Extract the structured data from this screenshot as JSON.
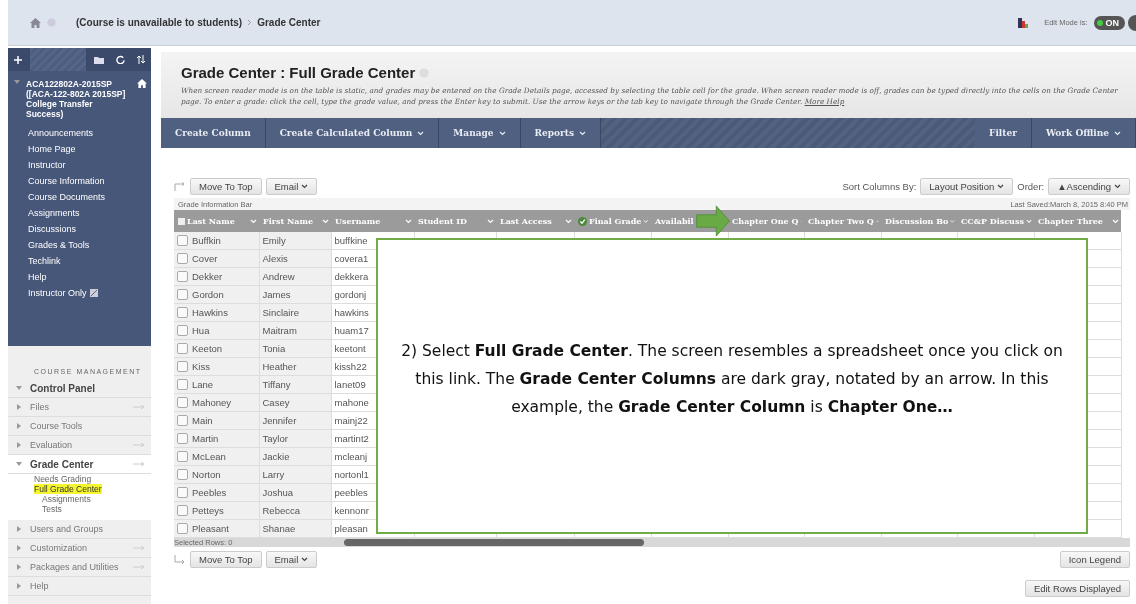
{
  "breadcrumb": {
    "items": [
      "(Course is unavailable to students)",
      "Grade Center"
    ]
  },
  "edit_mode": {
    "label": "Edit Mode is:",
    "value": "ON",
    "on": true
  },
  "sidebar": {
    "course_title": "ACA122802A-2015SP ([ACA-122-802A 2015SP] College Transfer Success)",
    "items": [
      {
        "label": "Announcements"
      },
      {
        "label": "Home Page"
      },
      {
        "label": "Instructor"
      },
      {
        "label": "Course Information"
      },
      {
        "label": "Course Documents"
      },
      {
        "label": "Assignments"
      },
      {
        "label": "Discussions"
      },
      {
        "label": "Grades & Tools"
      },
      {
        "label": "Techlink"
      },
      {
        "label": "Help"
      },
      {
        "label": "Instructor Only",
        "hidden_icon": true
      }
    ],
    "management_heading": "COURSE MANAGEMENT",
    "control_panel": "Control Panel",
    "panel_items": [
      {
        "label": "Files",
        "expanded": false,
        "quick_link": true
      },
      {
        "label": "Course Tools",
        "expanded": false,
        "quick_link": false
      },
      {
        "label": "Evaluation",
        "expanded": false,
        "quick_link": true
      },
      {
        "label": "Grade Center",
        "expanded": true,
        "quick_link": true,
        "children": [
          {
            "label": "Needs Grading",
            "selected": false
          },
          {
            "label": "Full Grade Center",
            "selected": true,
            "children": [
              {
                "label": "Assignments",
                "selected": false
              },
              {
                "label": "Tests",
                "selected": false
              }
            ]
          }
        ]
      },
      {
        "label": "Users and Groups",
        "expanded": false,
        "quick_link": false
      },
      {
        "label": "Customization",
        "expanded": false,
        "quick_link": true
      },
      {
        "label": "Packages and Utilities",
        "expanded": false,
        "quick_link": true
      },
      {
        "label": "Help",
        "expanded": false,
        "quick_link": false
      }
    ]
  },
  "page": {
    "title": "Grade Center : Full Grade Center",
    "description": "When screen reader mode is on the table is static, and grades may be entered on the Grade Details page, accessed by selecting the table cell for the grade. When screen reader mode is off, grades can be typed directly into the cells on the Grade Center page. To enter a grade: click the cell, type the grade value, and press the Enter key to submit. Use the arrow keys or the tab key to navigate through the Grade Center.",
    "help_link": "More Help"
  },
  "toolbar": {
    "left": [
      {
        "label": "Create Column",
        "menu": false
      },
      {
        "label": "Create Calculated Column",
        "menu": true
      },
      {
        "label": "Manage",
        "menu": true
      },
      {
        "label": "Reports",
        "menu": true
      }
    ],
    "right": [
      {
        "label": "Filter",
        "menu": false
      },
      {
        "label": "Work Offline",
        "menu": true
      }
    ]
  },
  "actions": {
    "move_to_top": "Move To Top",
    "email": "Email",
    "sort_label": "Sort Columns By:",
    "sort_value": "Layout Position",
    "order_label": "Order:",
    "order_value": "▲Ascending"
  },
  "info_bar": {
    "label": "Grade Information Bar",
    "last_saved": "Last Saved:March 8, 2015 8:40 PM"
  },
  "table": {
    "columns": [
      {
        "label": "Last Name"
      },
      {
        "label": "First Name"
      },
      {
        "label": "Username"
      },
      {
        "label": "Student ID"
      },
      {
        "label": "Last Access"
      },
      {
        "label": "Final Grade",
        "check": true
      },
      {
        "label": "Availabil"
      },
      {
        "label": "Chapter One Q"
      },
      {
        "label": "Chapter Two Q"
      },
      {
        "label": "Discussion Bo"
      },
      {
        "label": "CC&P Discuss"
      },
      {
        "label": "Chapter Three"
      }
    ],
    "rows": [
      {
        "last": "Buffkin",
        "first": "Emily",
        "user": "buffkine",
        "selected": false
      },
      {
        "last": "Cover",
        "first": "Alexis",
        "user": "covera1",
        "selected": false
      },
      {
        "last": "Dekker",
        "first": "Andrew",
        "user": "dekkera",
        "selected": false
      },
      {
        "last": "Gordon",
        "first": "James",
        "user": "gordonj",
        "selected": false
      },
      {
        "last": "Hawkins",
        "first": "Sinclaire",
        "user": "hawkins",
        "selected": false
      },
      {
        "last": "Hua",
        "first": "Maitram",
        "user": "huam17",
        "selected": false
      },
      {
        "last": "Keeton",
        "first": "Tonia",
        "user": "keetont",
        "selected": false
      },
      {
        "last": "Kiss",
        "first": "Heather",
        "user": "kissh22",
        "selected": false
      },
      {
        "last": "Lane",
        "first": "Tiffany",
        "user": "lanet09",
        "selected": false
      },
      {
        "last": "Mahoney",
        "first": "Casey",
        "user": "mahone",
        "selected": false
      },
      {
        "last": "Main",
        "first": "Jennifer",
        "user": "mainj22",
        "selected": false
      },
      {
        "last": "Martin",
        "first": "Taylor",
        "user": "martint2",
        "selected": false
      },
      {
        "last": "McLean",
        "first": "Jackie",
        "user": "mcleanj",
        "selected": false
      },
      {
        "last": "Norton",
        "first": "Larry",
        "user": "nortonl1",
        "selected": false
      },
      {
        "last": "Peebles",
        "first": "Joshua",
        "user": "peebles",
        "selected": false
      },
      {
        "last": "Petteys",
        "first": "Rebecca",
        "user": "kennonr",
        "selected": false
      },
      {
        "last": "Pleasant",
        "first": "Shanae",
        "user": "pleasan",
        "selected": false
      }
    ],
    "all_selected": false,
    "selected_rows": "Selected Rows: 0"
  },
  "footer": {
    "move_to_top": "Move To Top",
    "email": "Email",
    "icon_legend": "Icon Legend",
    "edit_rows": "Edit Rows Displayed"
  },
  "callout": {
    "text": "2) Select **Full Grade Center**. The screen resembles a spreadsheet once you click on this link. The **Grade Center Columns** are dark gray, notated by an arrow. In this example, the **Grade Center Column** is **Chapter One…**"
  }
}
